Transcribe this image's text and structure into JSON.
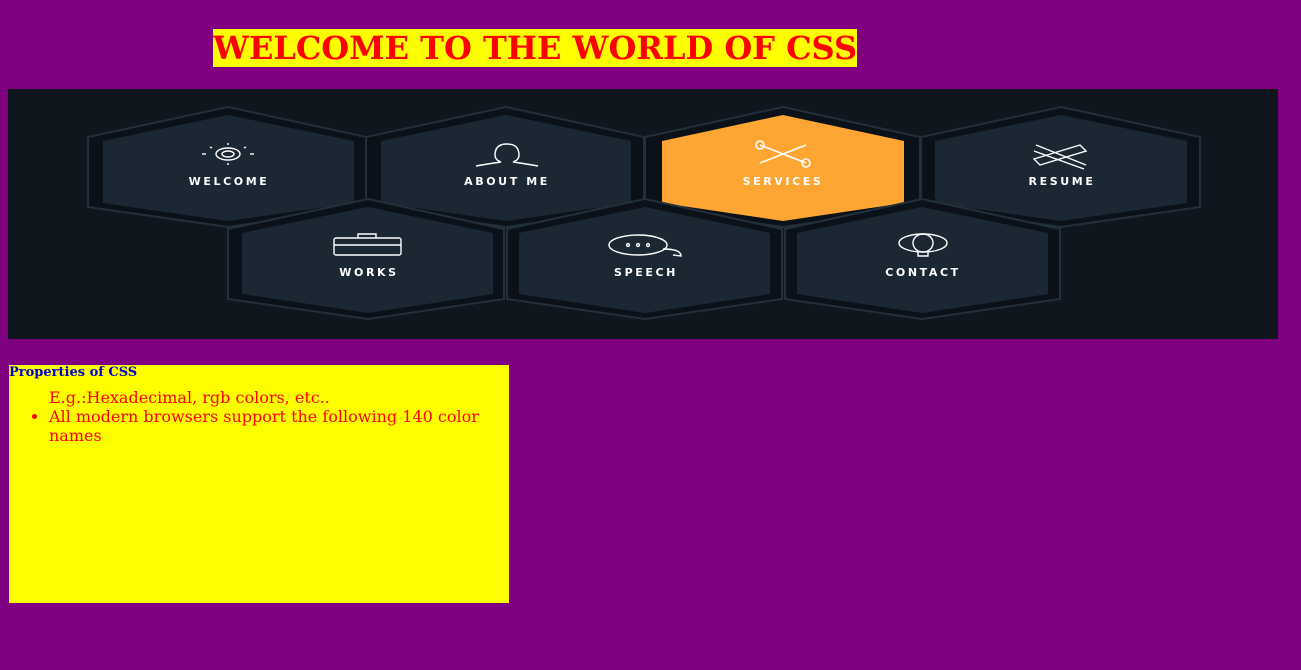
{
  "page": {
    "title": "WELCOME TO THE WORLD OF CSS"
  },
  "nav": {
    "items": [
      {
        "label": "WELCOME",
        "icon": "sun-icon",
        "active": false
      },
      {
        "label": "ABOUT ME",
        "icon": "user-icon",
        "active": false
      },
      {
        "label": "SERVICES",
        "icon": "tools-icon",
        "active": true
      },
      {
        "label": "RESUME",
        "icon": "pencil-ruler-icon",
        "active": false
      },
      {
        "label": "WORKS",
        "icon": "briefcase-icon",
        "active": false
      },
      {
        "label": "SPEECH",
        "icon": "speech-bubble-icon",
        "active": false
      },
      {
        "label": "CONTACT",
        "icon": "balloon-icon",
        "active": false
      }
    ]
  },
  "properties": {
    "heading": "Properties of CSS",
    "item1_continuation": "E.g.:Hexadecimal, rgb colors, etc..",
    "item2": "All modern browsers support the following 140 color names"
  },
  "colors": {
    "page_bg": "#800080",
    "title_bg": "#ffff00",
    "title_text": "#ff0000",
    "banner_bg": "#10161d",
    "hex_fill": "#1b2833",
    "hex_active": "#ffa534",
    "box_bg": "#ffff00",
    "heading_text": "#0000cc",
    "list_text": "#ff0000"
  }
}
